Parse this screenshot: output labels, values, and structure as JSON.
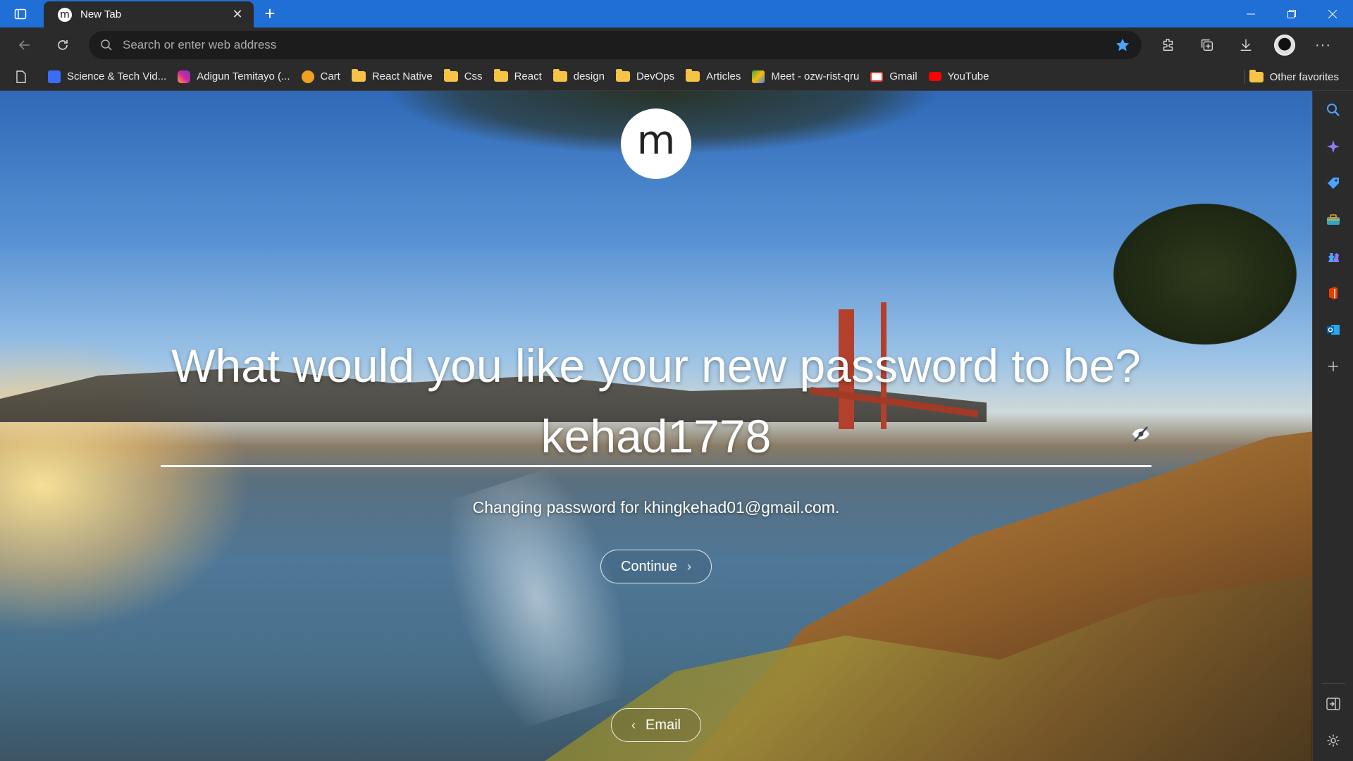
{
  "browser": {
    "tab": {
      "title": "New Tab",
      "favicon_letter": "m"
    },
    "address_bar": {
      "placeholder": "Search or enter web address"
    },
    "bookmarks": [
      {
        "label": "Science & Tech Vid...",
        "icon": "science-tech-icon",
        "color": "#3b6cf5"
      },
      {
        "label": "Adigun Temitayo (...",
        "icon": "instagram-icon",
        "color": "#d6249f"
      },
      {
        "label": "Cart",
        "icon": "cart-star-icon",
        "color": "#f0a020"
      },
      {
        "label": "React Native",
        "icon": "folder-icon"
      },
      {
        "label": "Css",
        "icon": "folder-icon"
      },
      {
        "label": "React",
        "icon": "folder-icon"
      },
      {
        "label": "design",
        "icon": "folder-icon"
      },
      {
        "label": "DevOps",
        "icon": "folder-icon"
      },
      {
        "label": "Articles",
        "icon": "folder-icon"
      },
      {
        "label": "Meet - ozw-rist-qru",
        "icon": "google-meet-icon",
        "color": "#34a853"
      },
      {
        "label": "Gmail",
        "icon": "gmail-icon",
        "color": "#ea4335"
      },
      {
        "label": "YouTube",
        "icon": "youtube-icon",
        "color": "#ff0000"
      }
    ],
    "other_favorites": "Other favorites"
  },
  "page": {
    "logo_letter": "m",
    "question": "What would you like your new password to be?",
    "password_value": "kehad1778",
    "helper_text": "Changing password for khingkehad01@gmail.com.",
    "continue_label": "Continue",
    "email_label": "Email"
  },
  "colors": {
    "titlebar": "#1f6fd6",
    "chrome": "#2b2b2b",
    "folder": "#f6c344",
    "favorite_star": "#4aa3ff"
  }
}
